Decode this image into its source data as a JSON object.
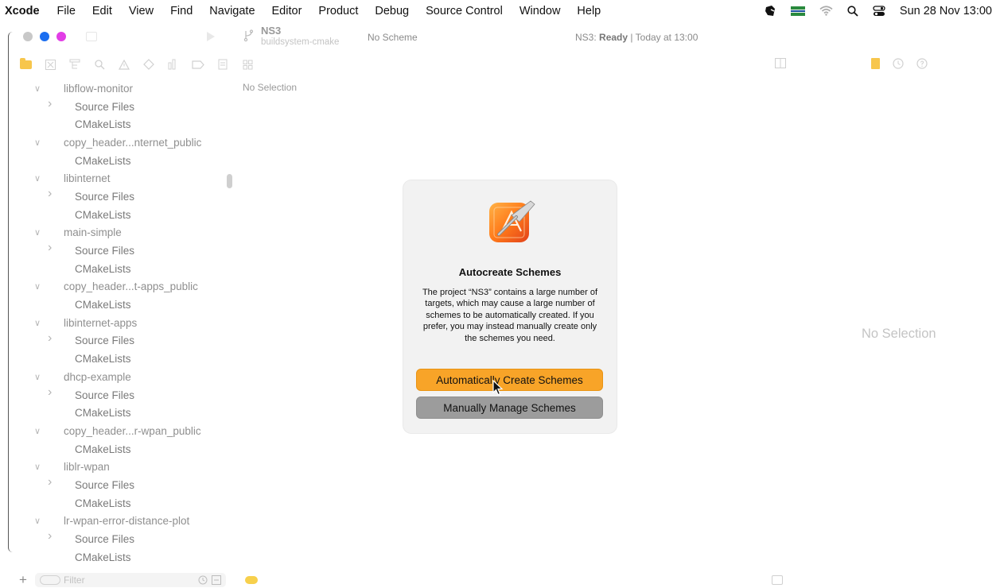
{
  "menubar": {
    "app": "Xcode",
    "items": [
      "File",
      "Edit",
      "View",
      "Find",
      "Navigate",
      "Editor",
      "Product",
      "Debug",
      "Source Control",
      "Window",
      "Help"
    ],
    "clock": "Sun 28 Nov  13:00"
  },
  "toolbar": {
    "project_name": "NS3",
    "branch": "buildsystem-cmake",
    "scheme": "No Scheme",
    "status_project": "NS3:",
    "status_state": "Ready",
    "status_time": "| Today at 13:00"
  },
  "navigator": {
    "tree": [
      {
        "level": 1,
        "label": "libflow-monitor",
        "expanded": true
      },
      {
        "level": 2,
        "label": "Source Files",
        "expandable": true
      },
      {
        "level": 2,
        "label": "CMakeLists",
        "expandable": false
      },
      {
        "level": 1,
        "label": "copy_header...nternet_public",
        "expanded": true
      },
      {
        "level": 2,
        "label": "CMakeLists",
        "expandable": false
      },
      {
        "level": 1,
        "label": "libinternet",
        "expanded": true
      },
      {
        "level": 2,
        "label": "Source Files",
        "expandable": true
      },
      {
        "level": 2,
        "label": "CMakeLists",
        "expandable": false
      },
      {
        "level": 1,
        "label": "main-simple",
        "expanded": true
      },
      {
        "level": 2,
        "label": "Source Files",
        "expandable": true
      },
      {
        "level": 2,
        "label": "CMakeLists",
        "expandable": false
      },
      {
        "level": 1,
        "label": "copy_header...t-apps_public",
        "expanded": true
      },
      {
        "level": 2,
        "label": "CMakeLists",
        "expandable": false
      },
      {
        "level": 1,
        "label": "libinternet-apps",
        "expanded": true
      },
      {
        "level": 2,
        "label": "Source Files",
        "expandable": true
      },
      {
        "level": 2,
        "label": "CMakeLists",
        "expandable": false
      },
      {
        "level": 1,
        "label": "dhcp-example",
        "expanded": true
      },
      {
        "level": 2,
        "label": "Source Files",
        "expandable": true
      },
      {
        "level": 2,
        "label": "CMakeLists",
        "expandable": false
      },
      {
        "level": 1,
        "label": "copy_header...r-wpan_public",
        "expanded": true
      },
      {
        "level": 2,
        "label": "CMakeLists",
        "expandable": false
      },
      {
        "level": 1,
        "label": "liblr-wpan",
        "expanded": true
      },
      {
        "level": 2,
        "label": "Source Files",
        "expandable": true
      },
      {
        "level": 2,
        "label": "CMakeLists",
        "expandable": false
      },
      {
        "level": 1,
        "label": "lr-wpan-error-distance-plot",
        "expanded": true
      },
      {
        "level": 2,
        "label": "Source Files",
        "expandable": true
      },
      {
        "level": 2,
        "label": "CMakeLists",
        "expandable": false
      }
    ],
    "filter_placeholder": "Filter"
  },
  "editor": {
    "no_selection": "No Selection"
  },
  "inspector": {
    "no_selection": "No Selection"
  },
  "dialog": {
    "title": "Autocreate Schemes",
    "body": "The project “NS3” contains a large number of targets, which may cause a large number of schemes to be automatically created. If you prefer, you may instead manually create only the schemes you need.",
    "primary_button": "Automatically Create Schemes",
    "secondary_button": "Manually Manage Schemes"
  },
  "colors": {
    "accent": "#f8a428",
    "folder": "#f7c64c",
    "traffic_min": "#1b6ef0",
    "traffic_max": "#e23de6"
  }
}
